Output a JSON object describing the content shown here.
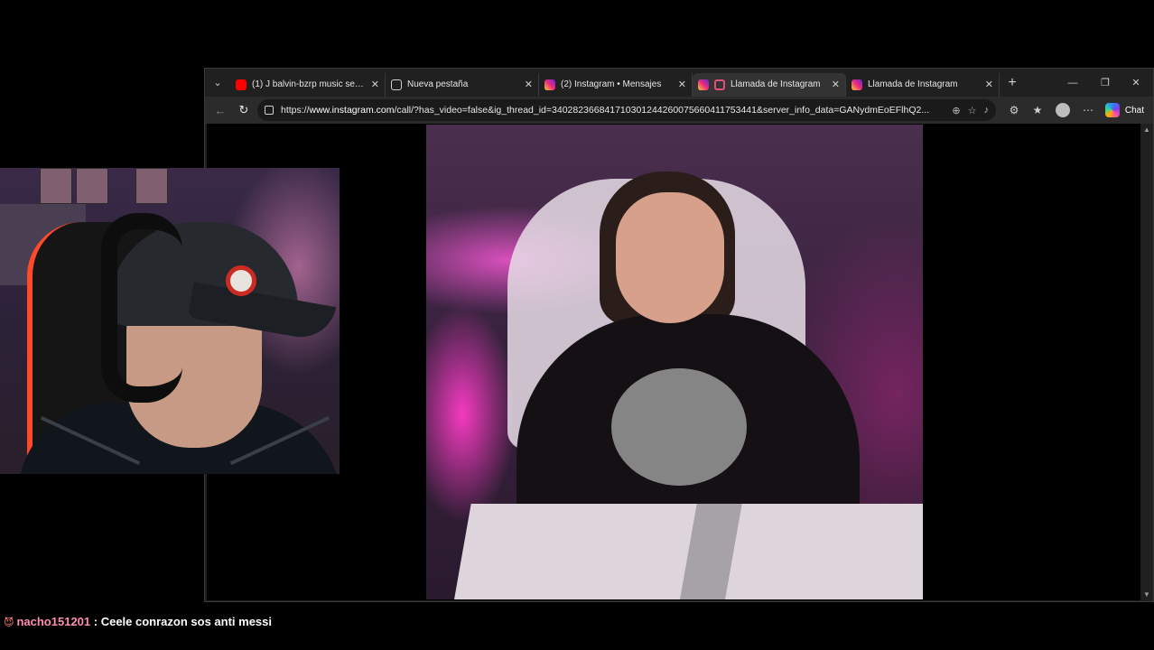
{
  "browser": {
    "tabs": [
      {
        "label": "(1) J balvin-bzrp music sesions",
        "icon": "youtube-icon",
        "active": false
      },
      {
        "label": "Nueva pestaña",
        "icon": "page-icon",
        "active": false
      },
      {
        "label": "(2) Instagram • Mensajes",
        "icon": "instagram-icon",
        "active": false
      },
      {
        "label": "Llamada de Instagram",
        "icon": "instagram-icon",
        "active": true
      },
      {
        "label": "Llamada de Instagram",
        "icon": "instagram-icon",
        "active": false
      }
    ],
    "url_prefix": "https://",
    "url_host": "www.instagram.com",
    "url_rest": "/call/?has_video=false&ig_thread_id=340282366841710301244260075660411753441&server_info_data=GANydmEoEFlhQ2...",
    "chat_label": "Chat"
  },
  "chat": {
    "badge": "😈",
    "username": "nacho151201",
    "separator": " : ",
    "message": "Ceele conrazon sos anti messi"
  },
  "colors": {
    "browser_bg": "#202020",
    "omnibox_bg": "#1a1a1a",
    "username": "#ff8fb1"
  }
}
